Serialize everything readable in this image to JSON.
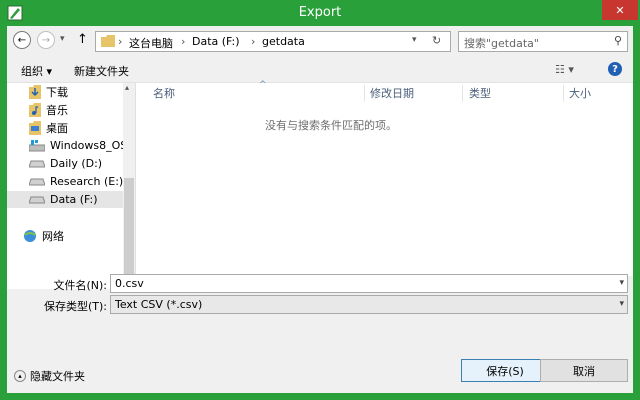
{
  "window": {
    "title": "Export",
    "close_glyph": "✕"
  },
  "nav": {
    "back_glyph": "←",
    "forward_glyph": "→",
    "dropdown_glyph": "▾",
    "up_glyph": "↑",
    "breadcrumb": [
      "这台电脑",
      "Data (F:)",
      "getdata"
    ],
    "separator_glyph": "›",
    "refresh_glyph": "↻",
    "search_placeholder": "搜索\"getdata\"",
    "search_glyph": "⚲"
  },
  "toolbar": {
    "organize": "组织 ▾",
    "new_folder": "新建文件夹",
    "view_glyph": "☷ ▾",
    "help_glyph": "?"
  },
  "sidebar": {
    "items": [
      {
        "label": "下载",
        "icon": "download-folder-icon"
      },
      {
        "label": "音乐",
        "icon": "music-folder-icon"
      },
      {
        "label": "桌面",
        "icon": "desktop-folder-icon"
      },
      {
        "label": "Windows8_OS (",
        "icon": "os-drive-icon"
      },
      {
        "label": "Daily (D:)",
        "icon": "drive-icon"
      },
      {
        "label": "Research (E:)",
        "icon": "drive-icon"
      },
      {
        "label": "Data (F:)",
        "icon": "drive-icon",
        "selected": true
      },
      {
        "label": "网络",
        "icon": "network-icon"
      }
    ]
  },
  "file_list": {
    "columns": [
      "名称",
      "修改日期",
      "类型",
      "大小"
    ],
    "sort_glyph": "^",
    "empty_message": "没有与搜索条件匹配的项。",
    "scroll_left": "‹",
    "scroll_right": "›"
  },
  "form": {
    "filename_label": "文件名(N):",
    "filename_value": "0.csv",
    "filetype_label": "保存类型(T):",
    "filetype_value": "Text CSV (*.csv)",
    "combo_arrow": "▾"
  },
  "footer": {
    "hide_folders": "隐藏文件夹",
    "hide_glyph": "▴",
    "save": "保存(S)",
    "cancel": "取消"
  },
  "colors": {
    "frame": "#29a03a",
    "close": "#c7372f",
    "accent": "#3c7fb1"
  }
}
